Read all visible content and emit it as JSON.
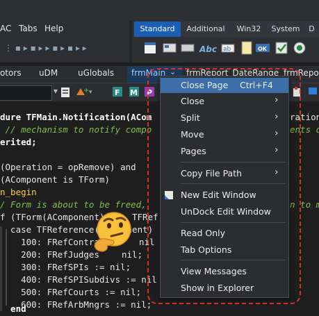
{
  "menubar": {
    "items": [
      "AC",
      "Tabs",
      "Help"
    ]
  },
  "palette": {
    "tabs": [
      "Standard",
      "Additional",
      "Win32",
      "System",
      "D"
    ]
  },
  "toolbar_icons": [
    "new-window-icon",
    "panel-icon",
    "button-icon",
    "text-abc-icon",
    "memo-icon",
    "ok-button-icon",
    "checkbox-icon",
    "radio-icon"
  ],
  "editor_tabs": [
    "otors",
    "uDM",
    "uGlobals",
    "frmMain",
    "frmReport_DateRange",
    "frmRepo"
  ],
  "code_lines": [
    {
      "t1": "dure TFMain.Notification(ACom",
      "t2": "ration"
    },
    {
      "t1": " // mechanism to notify compo",
      "t2": "ents d"
    },
    {
      "t1": "erited;"
    },
    {
      "t1": ""
    },
    {
      "t1": "(Operation = opRemove) and "
    },
    {
      "t1": "(AComponent is TForm)"
    },
    {
      "t1": "n_begin"
    },
    {
      "t1": "/ Form is about to be freed,",
      "t2": "n to m"
    },
    {
      "t1": "f (TForm(AComponent)",
      "t2": "TFRef"
    },
    {
      "t1": "  case TFReference(",
      "t2": "onent)"
    },
    {
      "t1": "    100: FRefContra",
      "t2": "nil"
    },
    {
      "t1": "    200: FRefJudges",
      "t2": "nil;"
    },
    {
      "t1": "    300: FRefSPIs := nil;"
    },
    {
      "t1": "    400: FRefSPISubdivs := nil"
    },
    {
      "t1": "    500: FRefCourts := nil;"
    },
    {
      "t1": "    600: FRefArbMngrs := nil;"
    },
    {
      "t1": "  end"
    }
  ],
  "context_menu": {
    "items": [
      {
        "label": "Close Page",
        "shortcut": "Ctrl+F4",
        "arrow": "",
        "highlight": true
      },
      {
        "label": "Close",
        "arrow": "›"
      },
      {
        "label": "Split",
        "arrow": "›"
      },
      {
        "label": "Move",
        "arrow": "›"
      },
      {
        "label": "Pages",
        "arrow": "›"
      },
      {
        "label": "Copy File Path",
        "arrow": "›"
      },
      {
        "label": "New Edit Window",
        "arrow": ""
      },
      {
        "label": "UnDock Edit Window",
        "arrow": ""
      },
      {
        "label": "Read Only",
        "arrow": ""
      },
      {
        "label": "Tab Options",
        "arrow": ""
      },
      {
        "label": "View Messages",
        "arrow": ""
      },
      {
        "label": "Show in Explorer",
        "arrow": ""
      }
    ]
  },
  "colors": {
    "highlight": "#3c6ea8",
    "dashed_border": "#d83030",
    "active_palette_tab": "#1a5fb4"
  }
}
